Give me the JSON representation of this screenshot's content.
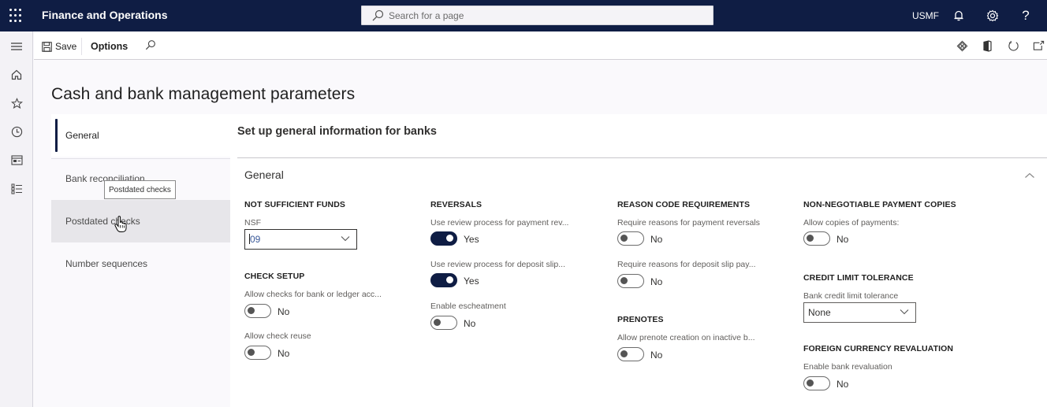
{
  "topbar": {
    "app_title": "Finance and Operations",
    "search_placeholder": "Search for a page",
    "company": "USMF",
    "icons": [
      "waffle-icon",
      "bell-icon",
      "gear-icon",
      "help-icon"
    ]
  },
  "rail": {
    "icons": [
      "hamburger-icon",
      "home-icon",
      "star-icon",
      "clock-icon",
      "workspace-icon",
      "list-icon"
    ]
  },
  "actionbar": {
    "save_label": "Save",
    "options_label": "Options",
    "right_icons": [
      "power-apps-icon",
      "office-icon",
      "refresh-icon",
      "open-new-window-icon"
    ]
  },
  "page": {
    "title": "Cash and bank management parameters"
  },
  "vtabs": [
    {
      "label": "General",
      "state": "active"
    },
    {
      "label": "Bank reconciliation",
      "state": "normal"
    },
    {
      "label": "Postdated checks",
      "state": "hover"
    },
    {
      "label": "Number sequences",
      "state": "normal"
    }
  ],
  "tooltip": "Postdated checks",
  "content": {
    "section_heading": "Set up general information for banks",
    "fasttab_title": "General",
    "columns": [
      {
        "groups": [
          {
            "heading": "NOT SUFFICIENT FUNDS",
            "fields": [
              {
                "label": "NSF",
                "type": "dropdown",
                "value": "09"
              }
            ]
          },
          {
            "heading": "CHECK SETUP",
            "fields": [
              {
                "label": "Allow checks for bank or ledger acc...",
                "type": "toggle",
                "value": "No"
              },
              {
                "label": "Allow check reuse",
                "type": "toggle",
                "value": "No"
              }
            ]
          }
        ]
      },
      {
        "groups": [
          {
            "heading": "REVERSALS",
            "fields": [
              {
                "label": "Use review process for payment rev...",
                "type": "toggle",
                "value": "Yes"
              },
              {
                "label": "Use review process for deposit slip...",
                "type": "toggle",
                "value": "Yes"
              },
              {
                "label": "Enable escheatment",
                "type": "toggle",
                "value": "No"
              }
            ]
          }
        ]
      },
      {
        "groups": [
          {
            "heading": "REASON CODE REQUIREMENTS",
            "fields": [
              {
                "label": "Require reasons for payment reversals",
                "type": "toggle",
                "value": "No"
              },
              {
                "label": "Require reasons for deposit slip pay...",
                "type": "toggle",
                "value": "No"
              }
            ]
          },
          {
            "heading": "PRENOTES",
            "fields": [
              {
                "label": "Allow prenote creation on inactive b...",
                "type": "toggle",
                "value": "No"
              }
            ]
          }
        ]
      },
      {
        "groups": [
          {
            "heading": "NON-NEGOTIABLE PAYMENT COPIES",
            "fields": [
              {
                "label": "Allow copies of payments:",
                "type": "toggle",
                "value": "No"
              }
            ]
          },
          {
            "heading": "CREDIT LIMIT TOLERANCE",
            "fields": [
              {
                "label": "Bank credit limit tolerance",
                "type": "dropdown",
                "value": "None"
              }
            ]
          },
          {
            "heading": "FOREIGN CURRENCY REVALUATION",
            "fields": [
              {
                "label": "Enable bank revaluation",
                "type": "toggle",
                "value": "No"
              }
            ]
          }
        ]
      }
    ]
  },
  "colors": {
    "nav_dark": "#0f1d44",
    "toggle_on": "#0f1d44",
    "background": "#faf9fc"
  }
}
